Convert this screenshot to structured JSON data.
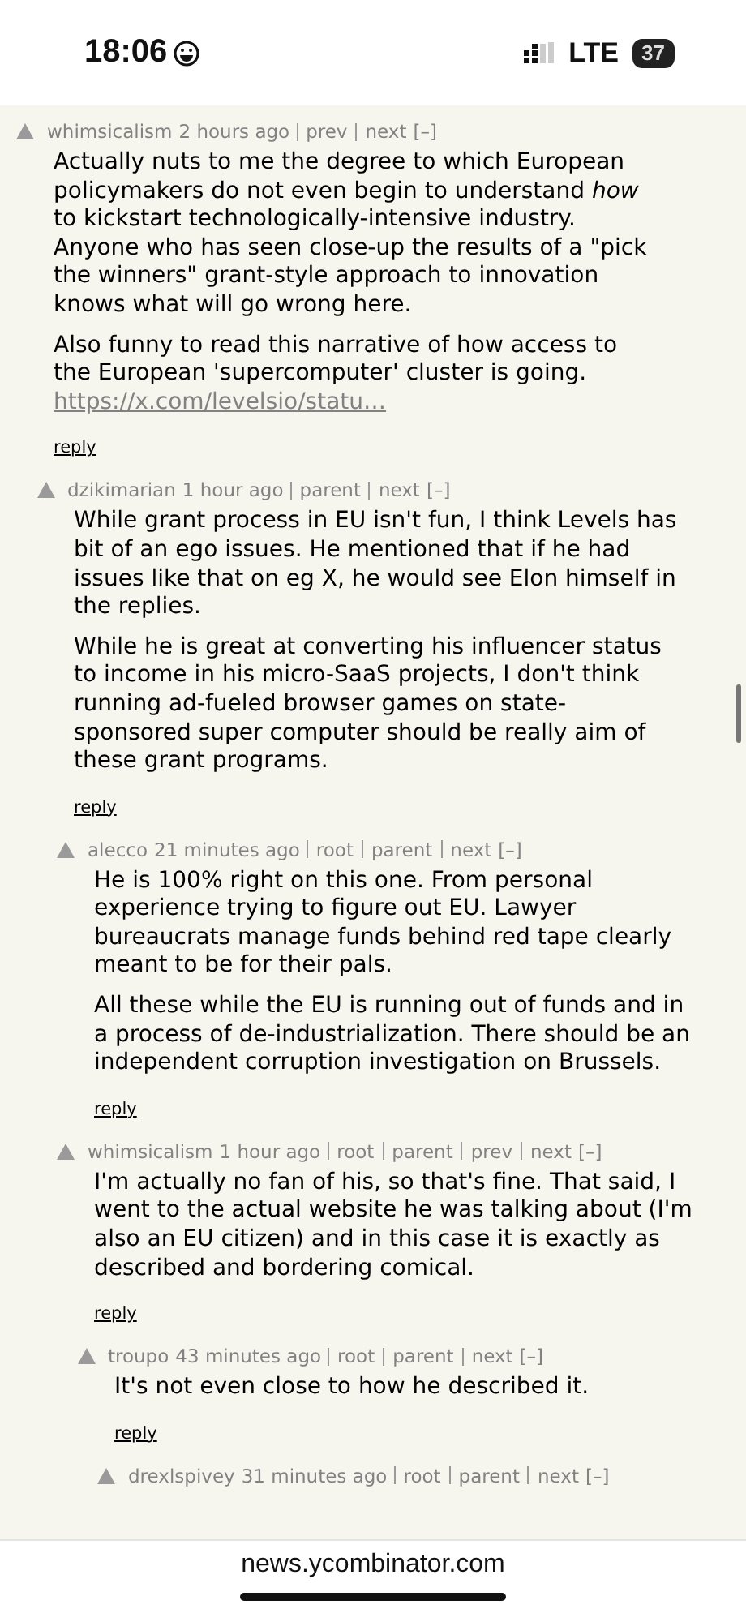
{
  "status_bar": {
    "time": "18:06",
    "network": "LTE",
    "battery": "37"
  },
  "comments": [
    {
      "user": "whimsicalism",
      "age": "2 hours ago",
      "links": [
        "prev",
        "next"
      ],
      "toggle": "[–]",
      "paragraphs": [
        {
          "text": "Actually nuts to me the degree to which European policymakers do not even begin to understand *how* to kickstart technologically-intensive industry. Anyone who has seen close-up the results of a \"pick the winners\" grant-style approach to innovation knows what will go wrong here."
        },
        {
          "text": "Also funny to read this narrative of how access to the European 'supercomputer' cluster is going.",
          "link": "https://x.com/levelsio/statu…"
        }
      ],
      "reply": "reply",
      "children": [
        {
          "user": "dzikimarian",
          "age": "1 hour ago",
          "links": [
            "parent",
            "next"
          ],
          "toggle": "[–]",
          "paragraphs": [
            {
              "text": "While grant process in EU isn't fun, I think Levels has bit of an ego issues. He mentioned that if he had issues like that on eg X, he would see Elon himself in the replies."
            },
            {
              "text": "While he is great at converting his influencer status to income in his micro-SaaS projects, I don't think running ad-fueled browser games on state-sponsored super computer should be really aim of these grant programs."
            }
          ],
          "reply": "reply",
          "children": [
            {
              "user": "alecco",
              "age": "21 minutes ago",
              "links": [
                "root",
                "parent",
                "next"
              ],
              "toggle": "[–]",
              "paragraphs": [
                {
                  "text": "He is 100% right on this one. From personal experience trying to figure out EU. Lawyer bureaucrats manage funds behind red tape clearly meant to be for their pals."
                },
                {
                  "text": "All these while the EU is running out of funds and in a process of de-industrialization. There should be an independent corruption investigation on Brussels."
                }
              ],
              "reply": "reply"
            },
            {
              "user": "whimsicalism",
              "age": "1 hour ago",
              "links": [
                "root",
                "parent",
                "prev",
                "next"
              ],
              "toggle": "[–]",
              "paragraphs": [
                {
                  "text": "I'm actually no fan of his, so that's fine. That said, I went to the actual website he was talking about (I'm also an EU citizen) and in this case it is exactly as described and bordering comical."
                }
              ],
              "reply": "reply",
              "children": [
                {
                  "user": "troupo",
                  "age": "43 minutes ago",
                  "links": [
                    "root",
                    "parent",
                    "next"
                  ],
                  "toggle": "[–]",
                  "paragraphs": [
                    {
                      "text": "It's not even close to how he described it."
                    }
                  ],
                  "reply": "reply",
                  "children": [
                    {
                      "user": "drexlspivey",
                      "age": "31 minutes ago",
                      "links": [
                        "root",
                        "parent",
                        "next"
                      ],
                      "toggle": "[–]"
                    }
                  ]
                }
              ]
            }
          ]
        }
      ]
    }
  ],
  "address_bar": {
    "url": "news.ycombinator.com"
  }
}
